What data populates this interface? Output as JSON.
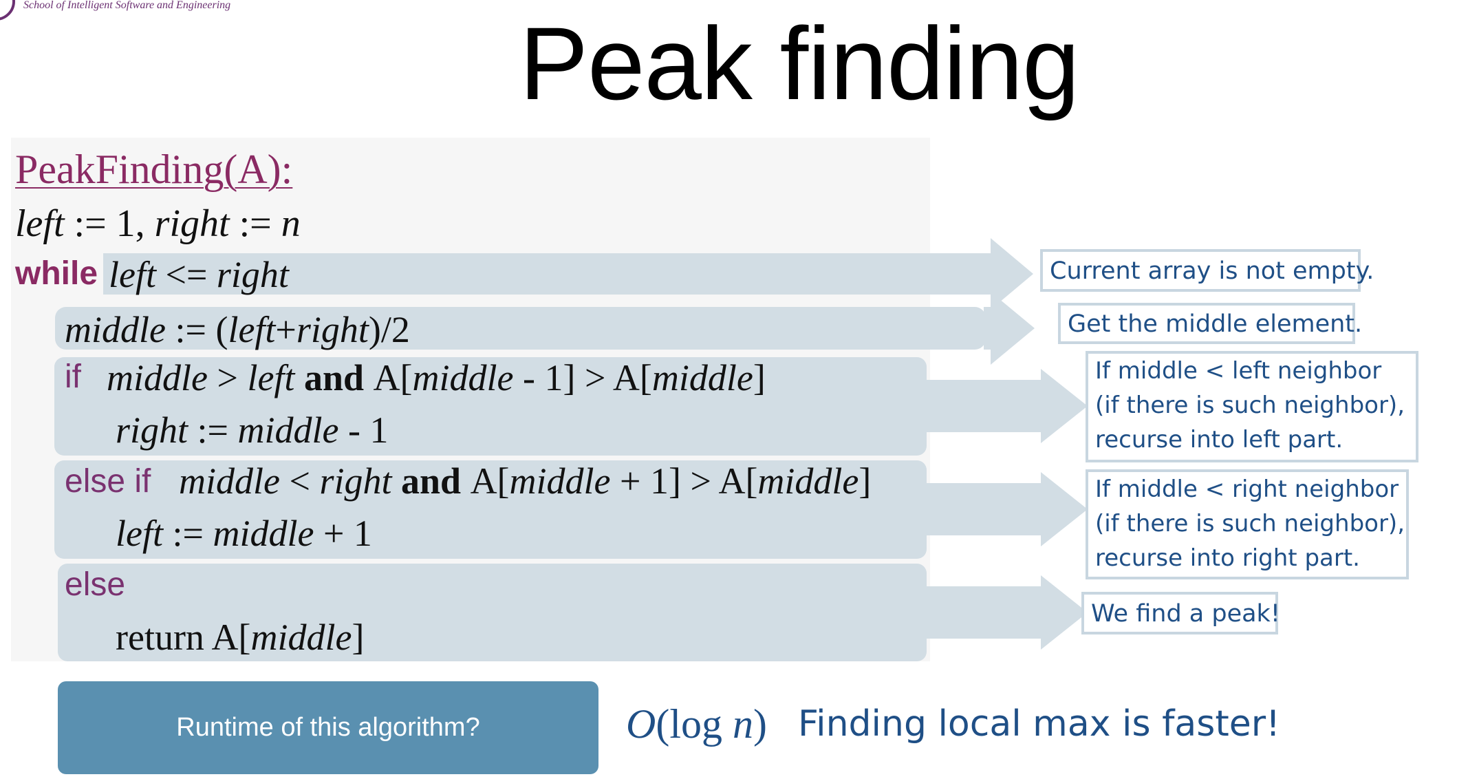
{
  "header": {
    "school_name": "School of Intelligent Software and Engineering",
    "title": "Peak finding"
  },
  "code": {
    "procedure": "PeakFinding(A):",
    "init": {
      "left_var": "left",
      "assign1": " := 1, ",
      "right_var": "right",
      "assign2": " := ",
      "n_var": "n"
    },
    "while_keyword": "while",
    "while_condition": {
      "left_var": "left",
      "op": " <= ",
      "right_var": "right"
    },
    "middle_line": {
      "middle_var": "middle",
      "assign": " :=  (",
      "left_var": "left",
      "plus": "+",
      "right_var": "right",
      "tail": ")/2"
    },
    "if_keyword": "if",
    "if_condition": {
      "middle_var": "middle",
      "op": " > ",
      "left_var": "left",
      "and": "  and  ",
      "a1": "A[",
      "middle_var2": "middle",
      "minus": " - 1] > A[",
      "middle_var3": "middle",
      "close": "]"
    },
    "if_body": {
      "right_var": "right",
      "assign": " := ",
      "middle_var": "middle",
      "tail": " - 1"
    },
    "elseif_keyword": "else if",
    "elseif_condition": {
      "middle_var": "middle",
      "op": " < ",
      "right_var": "right",
      "and": "  and  ",
      "a1": "A[",
      "middle_var2": "middle",
      "plus": " + 1] > A[",
      "middle_var3": "middle",
      "close": "]"
    },
    "elseif_body": {
      "left_var": "left",
      "assign": " := ",
      "middle_var": "middle",
      "tail": " + 1"
    },
    "else_keyword": "else",
    "else_body": {
      "return_kw": "return ",
      "a1": "A[",
      "middle_var": "middle",
      "close": "]"
    }
  },
  "notes": {
    "while": "Current array is not empty.",
    "middle": "Get the middle element.",
    "if_lines": [
      "If middle < left neighbor",
      "(if there is such neighbor),",
      "recurse into left part."
    ],
    "elseif_lines": [
      "If middle < right neighbor",
      "(if there is such neighbor),",
      "recurse into right part."
    ],
    "else": "We find a peak!"
  },
  "bottom": {
    "question_button": "Runtime of this algorithm?",
    "complexity": {
      "o": "O",
      "open": "(log ",
      "n": "n",
      "close": ")"
    },
    "remark": "Finding local max is faster!"
  },
  "colors": {
    "band": "#d2dde4",
    "keyword": "#8a2a63",
    "note_text": "#1f4f86",
    "button": "#5a90b0"
  }
}
